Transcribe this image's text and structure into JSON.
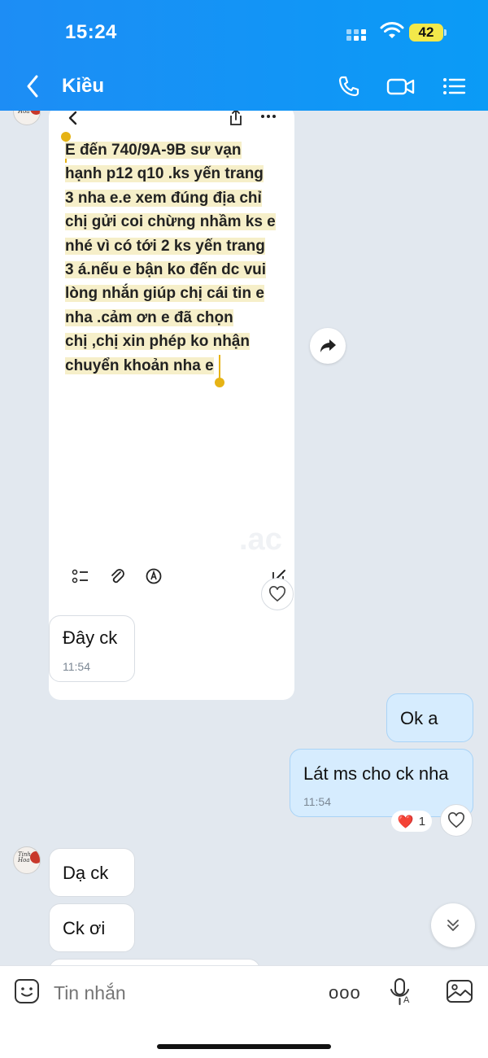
{
  "status_bar": {
    "time": "15:24",
    "battery": "42"
  },
  "header": {
    "title": "Kiều"
  },
  "shared_image": {
    "note_lines": [
      "E đến 740/9A-9B sư vạn",
      "hạnh p12 q10 .ks yến trang",
      "3 nha e.e xem đúng địa chỉ",
      "chị gửi coi chừng nhầm ks e",
      "nhé vì có tới 2 ks yến trang",
      "3 á.nếu e bận ko đến dc vui",
      "lòng nhắn giúp chị cái tin e",
      "nha .cảm ơn e đã chọn",
      "chị ,chị xin phép ko nhận",
      "chuyển khoản nha e"
    ],
    "watermark": ".ac"
  },
  "messages": [
    {
      "id": "m1",
      "side": "in",
      "text": "Đây ck",
      "time": "11:54"
    },
    {
      "id": "m2",
      "side": "out",
      "text": "Ok a"
    },
    {
      "id": "m3",
      "side": "out",
      "text": "Lát ms cho ck nha",
      "time": "11:54",
      "reaction": {
        "emoji": "❤️",
        "count": "1"
      }
    },
    {
      "id": "m4",
      "side": "in",
      "text": "Dạ ck"
    },
    {
      "id": "m5",
      "side": "in",
      "text": "Ck ơi"
    }
  ],
  "input": {
    "placeholder": "Tin nhắn",
    "more_label": "ooo"
  },
  "colors": {
    "header": "#1d8df5",
    "outgoing_bubble": "#d6ecfe",
    "background": "#e2e8ef"
  }
}
